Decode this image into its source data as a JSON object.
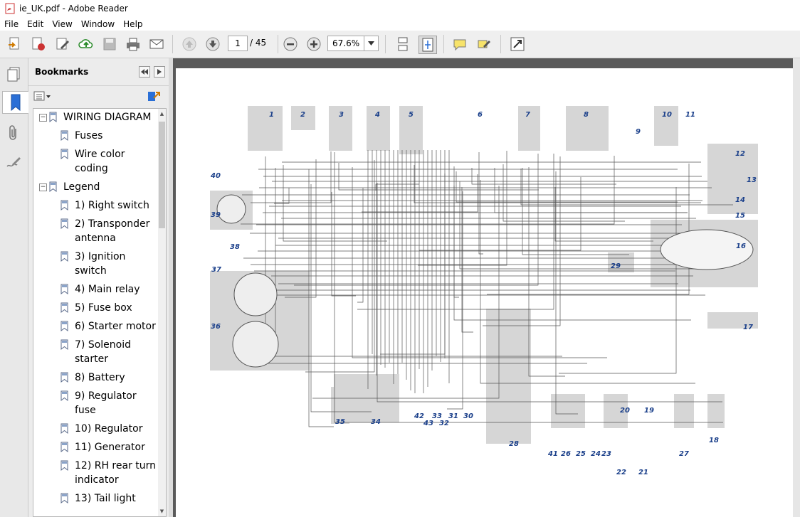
{
  "window": {
    "title": "ie_UK.pdf - Adobe Reader"
  },
  "menu": {
    "items": [
      "File",
      "Edit",
      "View",
      "Window",
      "Help"
    ]
  },
  "toolbar": {
    "page_current": "1",
    "page_total": "/ 45",
    "zoom": "67.6%"
  },
  "bookmarks": {
    "header": "Bookmarks",
    "items": [
      {
        "label": "WIRING DIAGRAM",
        "level": 0,
        "expanded": true
      },
      {
        "label": "Fuses",
        "level": 1
      },
      {
        "label": "Wire color coding",
        "level": 1
      },
      {
        "label": "Legend",
        "level": 0,
        "expanded": true
      },
      {
        "label": "1) Right switch",
        "level": 1
      },
      {
        "label": "2) Transponder antenna",
        "level": 1
      },
      {
        "label": "3) Ignition switch",
        "level": 1
      },
      {
        "label": "4) Main relay",
        "level": 1
      },
      {
        "label": "5) Fuse box",
        "level": 1
      },
      {
        "label": "6) Starter motor",
        "level": 1
      },
      {
        "label": "7) Solenoid starter",
        "level": 1
      },
      {
        "label": "8) Battery",
        "level": 1
      },
      {
        "label": "9) Regulator fuse",
        "level": 1
      },
      {
        "label": "10) Regulator",
        "level": 1
      },
      {
        "label": "11) Generator",
        "level": 1
      },
      {
        "label": "12) RH rear turn indicator",
        "level": 1
      },
      {
        "label": "13) Tail light",
        "level": 1
      }
    ]
  },
  "diagram": {
    "labels": [
      "1",
      "2",
      "3",
      "4",
      "5",
      "6",
      "7",
      "8",
      "9",
      "10",
      "11",
      "12",
      "13",
      "14",
      "15",
      "16",
      "17",
      "18",
      "19",
      "20",
      "21",
      "22",
      "23",
      "24",
      "25",
      "26",
      "27",
      "28",
      "29",
      "30",
      "31",
      "32",
      "33",
      "34",
      "35",
      "36",
      "37",
      "38",
      "39",
      "40",
      "41",
      "42",
      "43"
    ]
  },
  "colors": {
    "accent_red": "#e02020",
    "label_blue": "#1a3f8a"
  }
}
